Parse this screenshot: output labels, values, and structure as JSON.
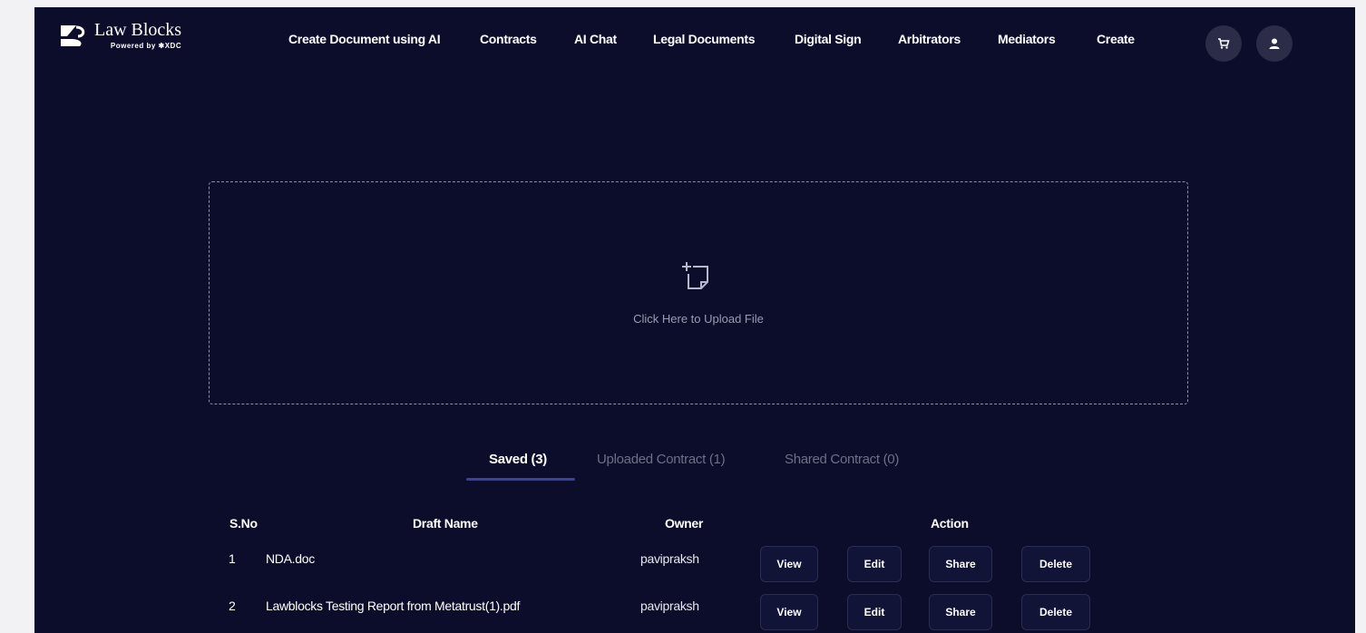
{
  "brand": {
    "name": "Law Blocks",
    "subtitle": "Powered by ✱XDC"
  },
  "nav": {
    "items": [
      {
        "label": "Create Document using AI"
      },
      {
        "label": "Contracts"
      },
      {
        "label": "AI Chat"
      },
      {
        "label": "Legal Documents"
      },
      {
        "label": "Digital Sign"
      },
      {
        "label": "Arbitrators"
      },
      {
        "label": "Mediators"
      },
      {
        "label": "Create"
      }
    ],
    "icons": [
      "cart-icon",
      "user-icon"
    ]
  },
  "upload": {
    "text": "Click Here to Upload File",
    "icon": "upload-file-icon"
  },
  "tabs": [
    {
      "label": "Saved (3)",
      "active": true
    },
    {
      "label": "Uploaded Contract (1)",
      "active": false
    },
    {
      "label": "Shared Contract (0)",
      "active": false
    }
  ],
  "table": {
    "headers": [
      "S.No",
      "Draft Name",
      "Owner",
      "Action"
    ],
    "rows": [
      {
        "sno": "1",
        "name": "NDA.doc",
        "owner": "pavipraksh"
      },
      {
        "sno": "2",
        "name": "Lawblocks Testing Report from Metatrust(1).pdf",
        "owner": "pavipraksh"
      }
    ],
    "actions": [
      "View",
      "Edit",
      "Share",
      "Delete"
    ]
  },
  "colors": {
    "background": "#0b0d2a",
    "page_gutter": "#f2f2f4",
    "accent_underline": "#3a3fa0",
    "button_bg": "#111437"
  }
}
